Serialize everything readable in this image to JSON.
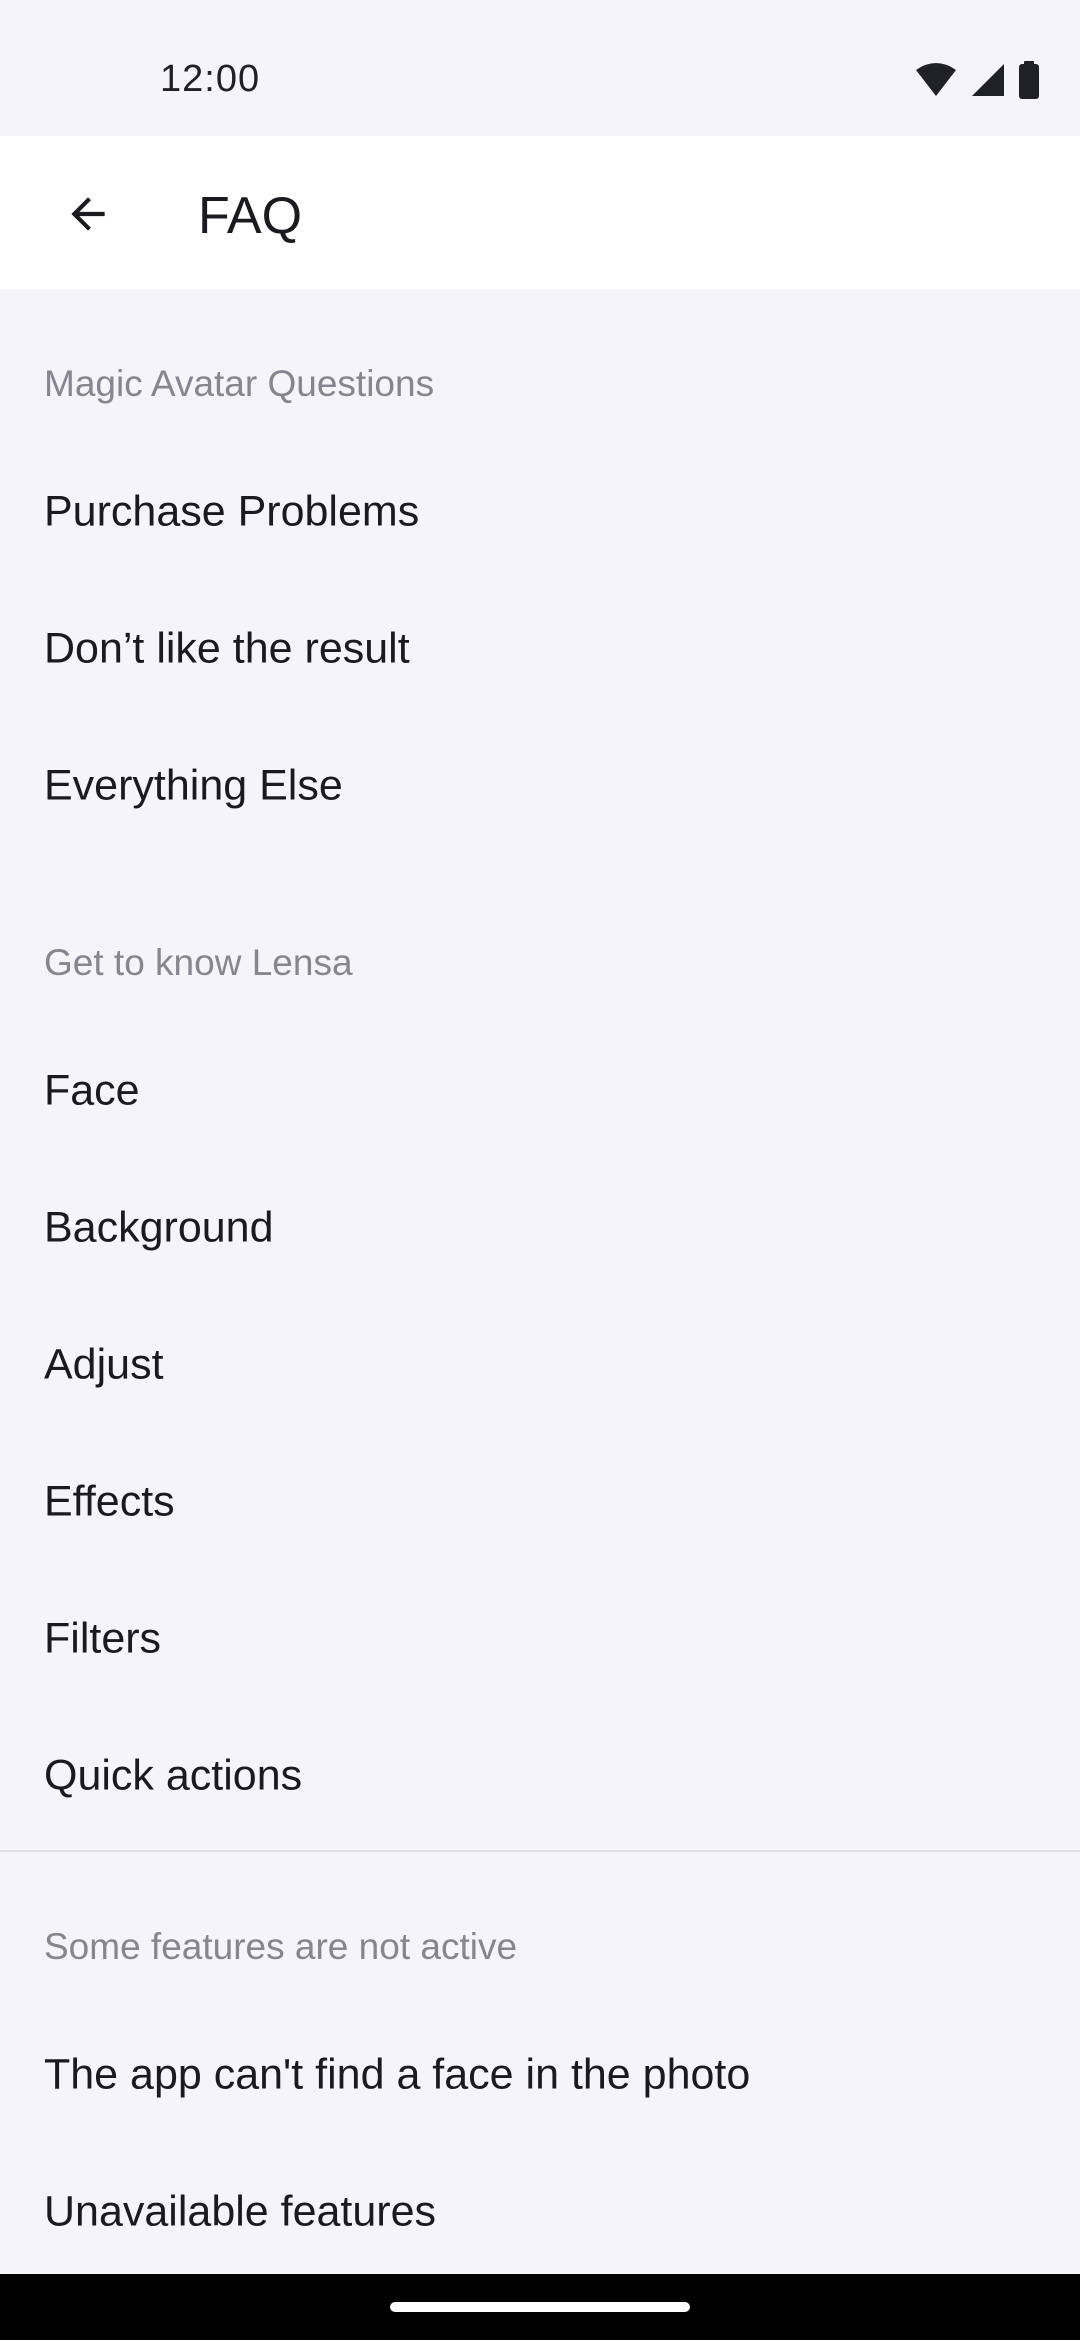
{
  "status_bar": {
    "time": "12:00"
  },
  "app_bar": {
    "title": "FAQ"
  },
  "sections": [
    {
      "header": "Magic Avatar Questions",
      "items": [
        "Purchase Problems",
        "Don’t like the result",
        "Everything Else"
      ]
    },
    {
      "header": "Get to know Lensa",
      "items": [
        "Face",
        "Background",
        "Adjust",
        "Effects",
        "Filters",
        "Quick actions"
      ]
    },
    {
      "header": "Some features are not active",
      "items": [
        "The app can't find a face in the photo",
        "Unavailable features"
      ]
    }
  ]
}
